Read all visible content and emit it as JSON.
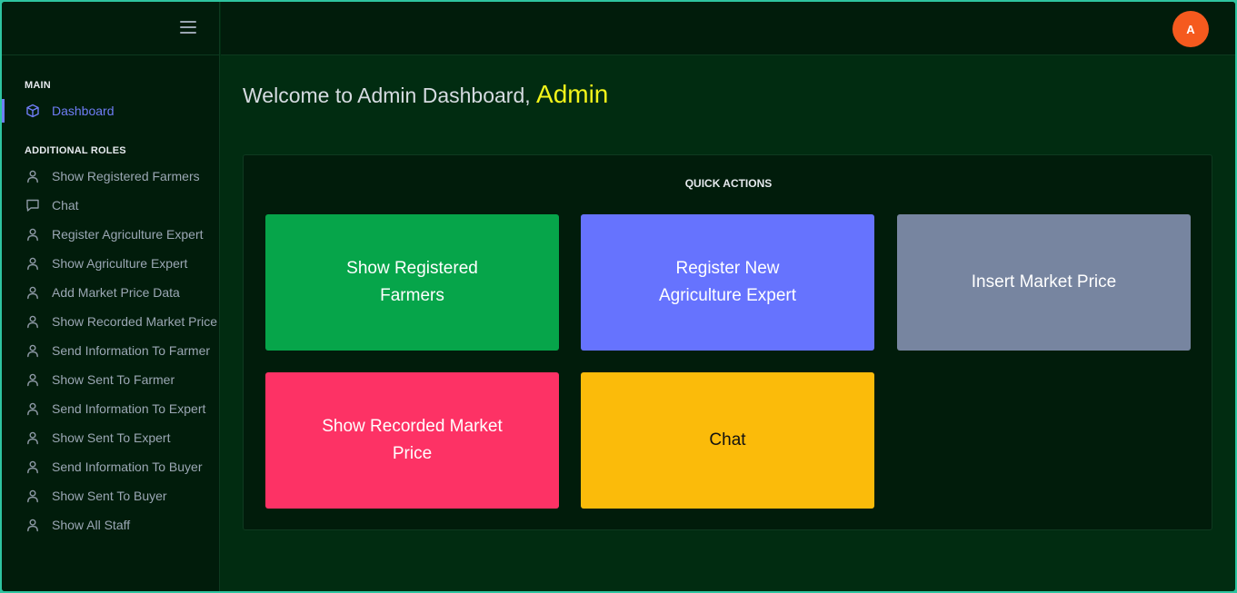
{
  "colors": {
    "sidebar_bg": "#011c0b",
    "main_bg": "#012c11",
    "accent": "#6f7df5",
    "admin_name": "#f3f41a",
    "avatar": "#f55a1e"
  },
  "topbar": {
    "avatar_initial": "A"
  },
  "sidebar": {
    "main_title": "MAIN",
    "dashboard_label": "Dashboard",
    "roles_title": "ADDITIONAL ROLES",
    "items": [
      {
        "label": "Show Registered Farmers",
        "icon": "user-icon"
      },
      {
        "label": "Chat",
        "icon": "chat-icon"
      },
      {
        "label": "Register Agriculture Expert",
        "icon": "user-icon"
      },
      {
        "label": "Show Agriculture Expert",
        "icon": "user-icon"
      },
      {
        "label": "Add Market Price Data",
        "icon": "user-icon"
      },
      {
        "label": "Show Recorded Market Price",
        "icon": "user-icon"
      },
      {
        "label": "Send Information To Farmer",
        "icon": "user-icon"
      },
      {
        "label": "Show Sent To Farmer",
        "icon": "user-icon"
      },
      {
        "label": "Send Information To Expert",
        "icon": "user-icon"
      },
      {
        "label": "Show Sent To Expert",
        "icon": "user-icon"
      },
      {
        "label": "Send Information To Buyer",
        "icon": "user-icon"
      },
      {
        "label": "Show Sent To Buyer",
        "icon": "user-icon"
      },
      {
        "label": "Show All Staff",
        "icon": "user-icon"
      }
    ]
  },
  "main": {
    "welcome_text": "Welcome to Admin Dashboard,",
    "admin_name": "Admin",
    "quick_actions_title": "QUICK ACTIONS",
    "tiles": [
      {
        "label": "Show Registered Farmers",
        "color": "#06a54a",
        "text_color": "#ffffff"
      },
      {
        "label": "Register New Agriculture Expert",
        "color": "#6673fe",
        "text_color": "#ffffff"
      },
      {
        "label": "Insert Market Price",
        "color": "#7785a0",
        "text_color": "#ffffff"
      },
      {
        "label": "Show Recorded Market Price",
        "color": "#fd3265",
        "text_color": "#ffffff"
      },
      {
        "label": "Chat",
        "color": "#fbbb0a",
        "text_color": "#111111"
      }
    ]
  }
}
